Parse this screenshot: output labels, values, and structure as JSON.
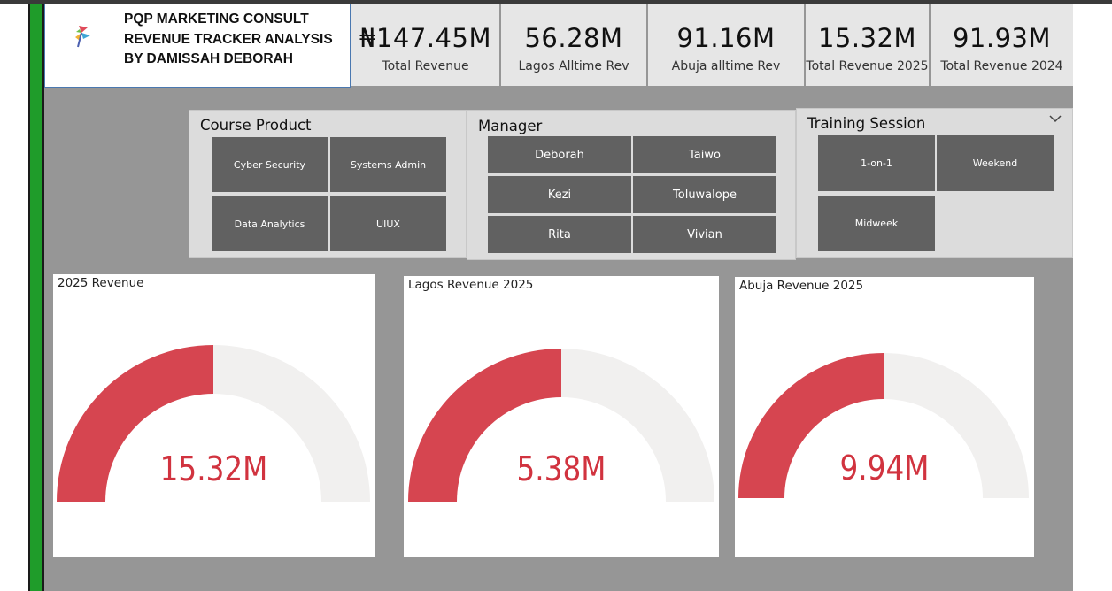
{
  "header": {
    "title_line1": "PQP MARKETING CONSULT",
    "title_line2": "REVENUE TRACKER  ANALYSIS",
    "title_line3": "BY DAMISSAH DEBORAH",
    "logo_icon": "pinwheel-logo-icon"
  },
  "kpis": [
    {
      "value": "₦147.45M",
      "label": "Total Revenue"
    },
    {
      "value": "56.28M",
      "label": "Lagos Alltime Rev"
    },
    {
      "value": "91.16M",
      "label": "Abuja alltime Rev"
    },
    {
      "value": "15.32M",
      "label": "Total Revenue 2025"
    },
    {
      "value": "91.93M",
      "label": "Total Revenue 2024"
    }
  ],
  "slicers": {
    "course_product": {
      "title": "Course Product",
      "options": [
        "Cyber Security",
        "Systems Admin",
        "Data Analytics",
        "UIUX"
      ]
    },
    "manager": {
      "title": "Manager",
      "options": [
        "Deborah",
        "Taiwo",
        "Kezi",
        "Toluwalope",
        "Rita",
        "Vivian"
      ]
    },
    "training_session": {
      "title": "Training Session",
      "options": [
        "1-on-1",
        "Weekend",
        "Midweek"
      ],
      "dropdown_icon": "chevron-down-icon"
    }
  },
  "gauges": [
    {
      "title": "2025 Revenue",
      "value": "15.32M",
      "fraction": 0.5
    },
    {
      "title": "Lagos Revenue 2025",
      "value": "5.38M",
      "fraction": 0.5
    },
    {
      "title": "Abuja Revenue 2025",
      "value": "9.94M",
      "fraction": 0.5
    }
  ],
  "colors": {
    "accent_green": "#1f9c2a",
    "gauge_fill": "#d64550",
    "gauge_track": "#f1f0ef",
    "gauge_value_text": "#d1333f",
    "tile": "#616161",
    "canvas": "#969696"
  }
}
